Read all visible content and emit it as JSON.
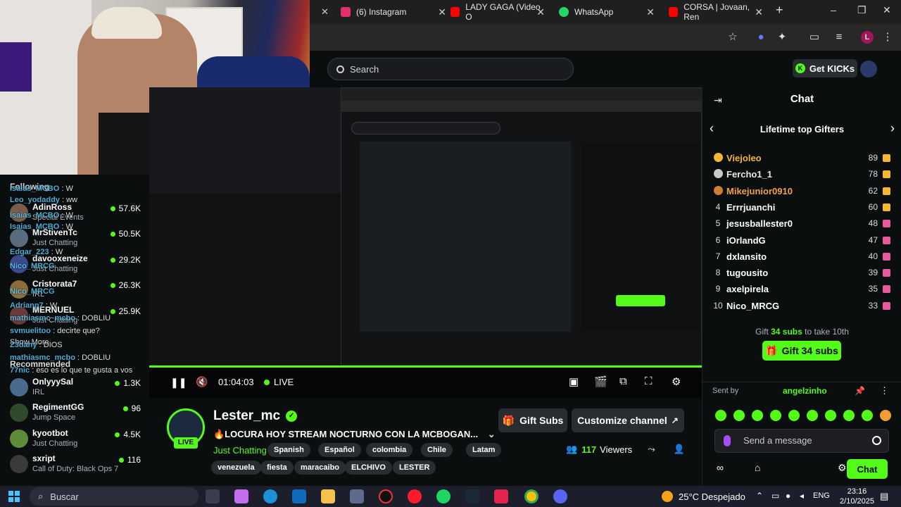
{
  "browser": {
    "tabs": [
      {
        "label": "(6) Instagram",
        "color": "#e1306c"
      },
      {
        "label": "LADY GAGA (Video O",
        "color": "#ff0000"
      },
      {
        "label": "WhatsApp",
        "color": "#25d366"
      },
      {
        "label": "CORSA | Jovaan, Ren",
        "color": "#ff0000"
      }
    ],
    "new_tab": "+",
    "win_minimize": "–",
    "win_maximize": "❐",
    "win_close": "✕",
    "profile_initial": "L"
  },
  "kick": {
    "search_placeholder": "Search",
    "get_kicks": "Get KICKs",
    "accent": "#53fc18"
  },
  "followed": {
    "channels": [
      {
        "name": "AdinRoss",
        "category": "Special Events",
        "viewers": "57.6K",
        "color": "#7a5c4a"
      },
      {
        "name": "MrStivenTc",
        "category": "Just Chatting",
        "viewers": "50.5K",
        "color": "#5a6b7d"
      },
      {
        "name": "davooxeneize",
        "category": "Just Chatting",
        "viewers": "29.2K",
        "color": "#3a4b8d"
      },
      {
        "name": "Cristorata7",
        "category": "IRL",
        "viewers": "26.3K",
        "color": "#8d6b3a"
      },
      {
        "name": "MERNUEL",
        "category": "Just Chatting",
        "viewers": "25.9K",
        "color": "#6b3a3a"
      },
      {
        "name": "OnlyyySal",
        "category": "IRL",
        "viewers": "1.3K",
        "color": "#4a6b8d"
      },
      {
        "name": "RegimentGG",
        "category": "Jump Space",
        "viewers": "96",
        "color": "#2d4a2d"
      },
      {
        "name": "kyootbot",
        "category": "Just Chatting",
        "viewers": "4.5K",
        "color": "#5e8d3a"
      },
      {
        "name": "sxript",
        "category": "Call of Duty: Black Ops 7",
        "viewers": "116",
        "color": "#3a3a3a"
      }
    ],
    "section_following": "Following",
    "section_recommended": "Recommended",
    "show_more": "Show More",
    "overlay_chat": [
      {
        "user": "Isaias_MCBO",
        "msg": "W"
      },
      {
        "user": "Leo_yodaddy",
        "msg": "ww"
      },
      {
        "user": "Isaias_MCBO",
        "msg": "W"
      },
      {
        "user": "Isaias_MCBO",
        "msg": "W"
      },
      {
        "user": "Edgar_223",
        "msg": "W"
      },
      {
        "user": "Nico_MRCG",
        "msg": ""
      },
      {
        "user": "Nico_MRCG",
        "msg": ""
      },
      {
        "user": "Adrianp7",
        "msg": "W"
      },
      {
        "user": "mathiasmc_mcbo",
        "msg": "DOBLIU"
      },
      {
        "user": "svmuelitoo",
        "msg": "decirte que?"
      },
      {
        "user": "Z3dahy",
        "msg": "DIOS"
      },
      {
        "user": "mathiasmc_mcbo",
        "msg": "DOBLIU"
      },
      {
        "user": "77nic",
        "msg": "eso es lo que te gusta a vos"
      }
    ]
  },
  "video": {
    "time": "01:04:03",
    "live": "LIVE",
    "progress": 1.0
  },
  "stream": {
    "channel": "Lester_mc",
    "live_badge": "LIVE",
    "title": "🔥LOCURA HOY STREAM NOCTURNO CON LA MCBOGAN...",
    "category": "Just Chatting",
    "tags_row1": [
      "Spanish",
      "Español",
      "colombia",
      "Chile",
      "Latam"
    ],
    "tags_row2": [
      "venezuela",
      "fiesta",
      "maracaibo",
      "ELCHIVO",
      "LESTER"
    ],
    "gift_subs": "Gift Subs",
    "customize": "Customize channel",
    "viewers": "117",
    "viewers_label": "Viewers"
  },
  "chat": {
    "title": "Chat",
    "gifters_title": "Lifetime top Gifters",
    "gifters": [
      {
        "rank": "1",
        "name": "Viejoleo",
        "count": "89",
        "color": "#f5b731",
        "medal": "#f5b731"
      },
      {
        "rank": "2",
        "name": "Fercho1_1",
        "count": "78",
        "color": "#e8e8e8",
        "medal": "#c9c9c9"
      },
      {
        "rank": "3",
        "name": "Mikejunior0910",
        "count": "62",
        "color": "#f0a24a",
        "medal": "#cd7f32"
      },
      {
        "rank": "4",
        "name": "Errrjuanchi",
        "count": "60",
        "color": "#ffffff",
        "medal": ""
      },
      {
        "rank": "5",
        "name": "jesusballester0",
        "count": "48",
        "color": "#ffffff",
        "medal": ""
      },
      {
        "rank": "6",
        "name": "iOrlandG",
        "count": "47",
        "color": "#ffffff",
        "medal": ""
      },
      {
        "rank": "7",
        "name": "dxlansito",
        "count": "40",
        "color": "#ffffff",
        "medal": ""
      },
      {
        "rank": "8",
        "name": "tugousito",
        "count": "39",
        "color": "#ffffff",
        "medal": ""
      },
      {
        "rank": "9",
        "name": "axelpirela",
        "count": "35",
        "color": "#ffffff",
        "medal": ""
      },
      {
        "rank": "10",
        "name": "Nico_MRCG",
        "count": "33",
        "color": "#ffffff",
        "medal": ""
      }
    ],
    "gift_line_pre": "Gift",
    "gift_line_count": "34 subs",
    "gift_line_post": "to take 10th",
    "gift_button": "Gift 34 subs",
    "pinned_label": "Sent by",
    "pinned_user": "angelzinho",
    "message_placeholder": "Send a message",
    "chat_button": "Chat"
  },
  "taskbar": {
    "search_placeholder": "Buscar",
    "weather": "25°C Despejado",
    "lang": "ENG",
    "time": "23:16",
    "date": "2/10/2025"
  }
}
